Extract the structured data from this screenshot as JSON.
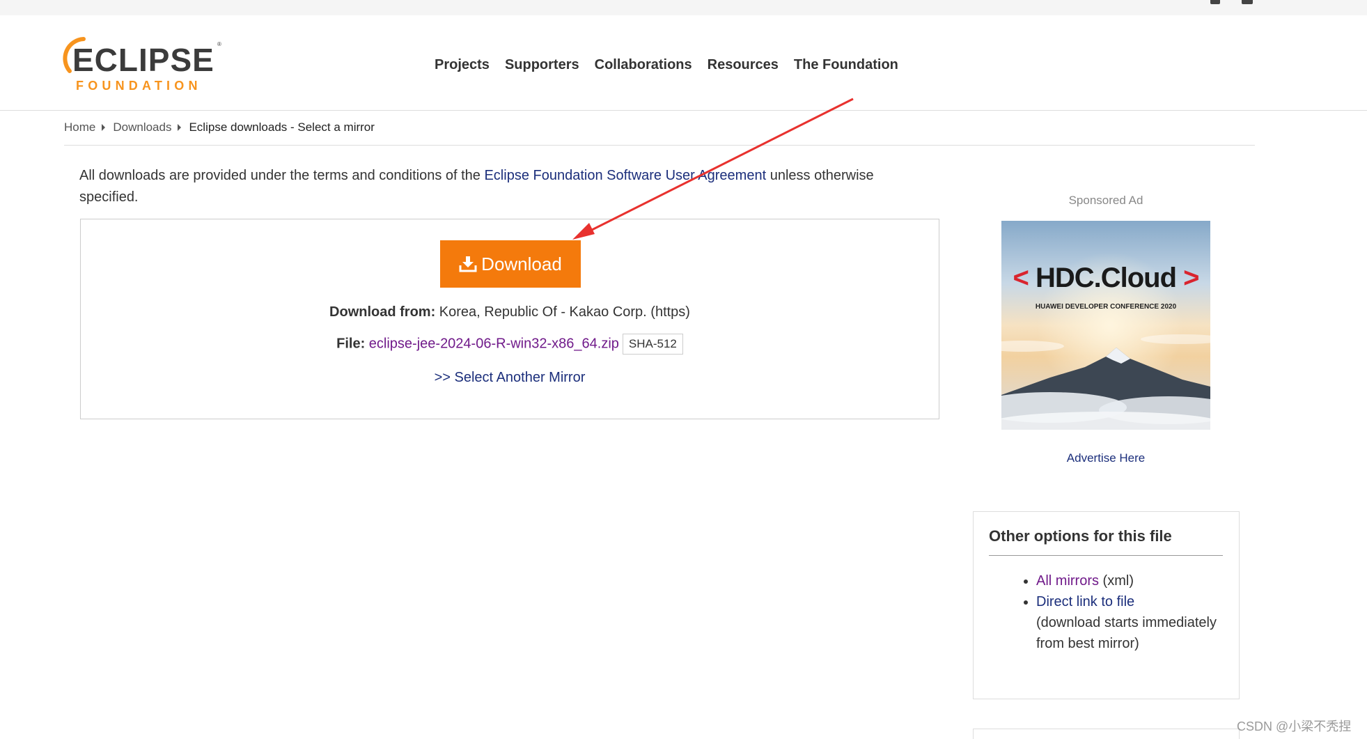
{
  "header": {
    "logo": {
      "wordmark": "ECLIPSE",
      "subline": "FOUNDATION",
      "mark_color": "#f7941e",
      "sub_color": "#f7941e"
    },
    "nav": [
      {
        "label": "Projects"
      },
      {
        "label": "Supporters"
      },
      {
        "label": "Collaborations"
      },
      {
        "label": "Resources"
      },
      {
        "label": "The Foundation"
      }
    ]
  },
  "breadcrumb": {
    "items": [
      {
        "label": "Home"
      },
      {
        "label": "Downloads"
      },
      {
        "label": "Eclipse downloads - Select a mirror"
      }
    ]
  },
  "terms": {
    "prefix": "All downloads are provided under the terms and conditions of the ",
    "link": "Eclipse Foundation Software User Agreement",
    "suffix": " unless otherwise specified."
  },
  "download": {
    "button_label": "Download",
    "button_color": "#f47a0c",
    "from_label": "Download from:",
    "from_value": " Korea, Republic Of - Kakao Corp. (https)",
    "file_label": "File:",
    "file_name": "eclipse-jee-2024-06-R-win32-x86_64.zip",
    "sha_label": "SHA-512",
    "another_mirror": ">> Select Another Mirror"
  },
  "sidebar": {
    "sponsored_label": "Sponsored Ad",
    "ad": {
      "bracket_left": "<",
      "title": "HDC.Cloud",
      "bracket_right": ">",
      "subtitle": "HUAWEI DEVELOPER CONFERENCE 2020"
    },
    "advertise_link": "Advertise Here",
    "options": {
      "title": "Other options for this file",
      "items": [
        {
          "link": "All mirrors",
          "suffix": " (xml)"
        },
        {
          "link": "Direct link to file",
          "note": "(download starts immediately from best mirror)"
        }
      ]
    }
  },
  "watermark": "CSDN @小梁不秃捏",
  "annotation": {
    "arrow_color": "#e8312e"
  }
}
